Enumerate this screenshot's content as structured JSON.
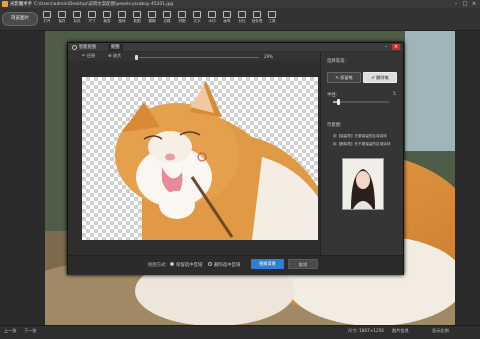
{
  "window": {
    "app_title": "光影魔术手",
    "file_path": "C:\\Users\\admin\\Desktop\\说明文案配图\\pexels-pixabay-45201.jpg",
    "min_label": "–",
    "max_label": "□",
    "close_label": "×"
  },
  "toolbar": {
    "browse_label": "浏览图片",
    "tools": [
      {
        "label": "打开",
        "icon": "folder-icon"
      },
      {
        "label": "保存",
        "icon": "save-icon"
      },
      {
        "label": "另存",
        "icon": "save-as-icon"
      },
      {
        "label": "尺寸",
        "icon": "resize-icon"
      },
      {
        "label": "裁剪",
        "icon": "crop-icon"
      },
      {
        "label": "旋转",
        "icon": "rotate-icon"
      },
      {
        "label": "抠图",
        "icon": "cutout-icon"
      },
      {
        "label": "模糊",
        "icon": "blur-icon"
      },
      {
        "label": "边框",
        "icon": "frame-icon"
      },
      {
        "label": "拼图",
        "icon": "collage-icon"
      },
      {
        "label": "文字",
        "icon": "text-icon"
      },
      {
        "label": "水印",
        "icon": "watermark-icon"
      },
      {
        "label": "画笔",
        "icon": "brush-icon"
      },
      {
        "label": "对比",
        "icon": "compare-icon"
      },
      {
        "label": "批处理",
        "icon": "batch-icon"
      },
      {
        "label": "工具",
        "icon": "tools-icon"
      }
    ]
  },
  "dialog": {
    "title": "智能抠图",
    "tab": "抠图",
    "tools": {
      "restore": "还原",
      "zoom_in": "放大"
    },
    "zoom_percent": "29%",
    "panel": {
      "select_title": "选择笔笔:",
      "keep_brush": "保留笔",
      "erase_brush": "删除笔",
      "brush_size_label": "半径:",
      "brush_size_value": "5",
      "tips_title": "示意图:",
      "tip_keep": "用【保留笔】在要保留的区域涂抹",
      "tip_erase": "用【删除笔】在不要保留的区域涂抹"
    },
    "bottom": {
      "mode_label": "抠图方式:",
      "option_keep": "保留选中区域",
      "option_erase": "删除选中区域",
      "save_label": "替换背景",
      "cancel_label": "取消"
    }
  },
  "statusbar": {
    "prev": "上一张",
    "next": "下一张",
    "size": "尺寸: 1867×1256",
    "info": "图片信息",
    "zoom": "显示比例"
  },
  "colors": {
    "accent_blue": "#2f7fd6",
    "close_red": "#c9302c",
    "cat_orange": "#d9893a"
  }
}
